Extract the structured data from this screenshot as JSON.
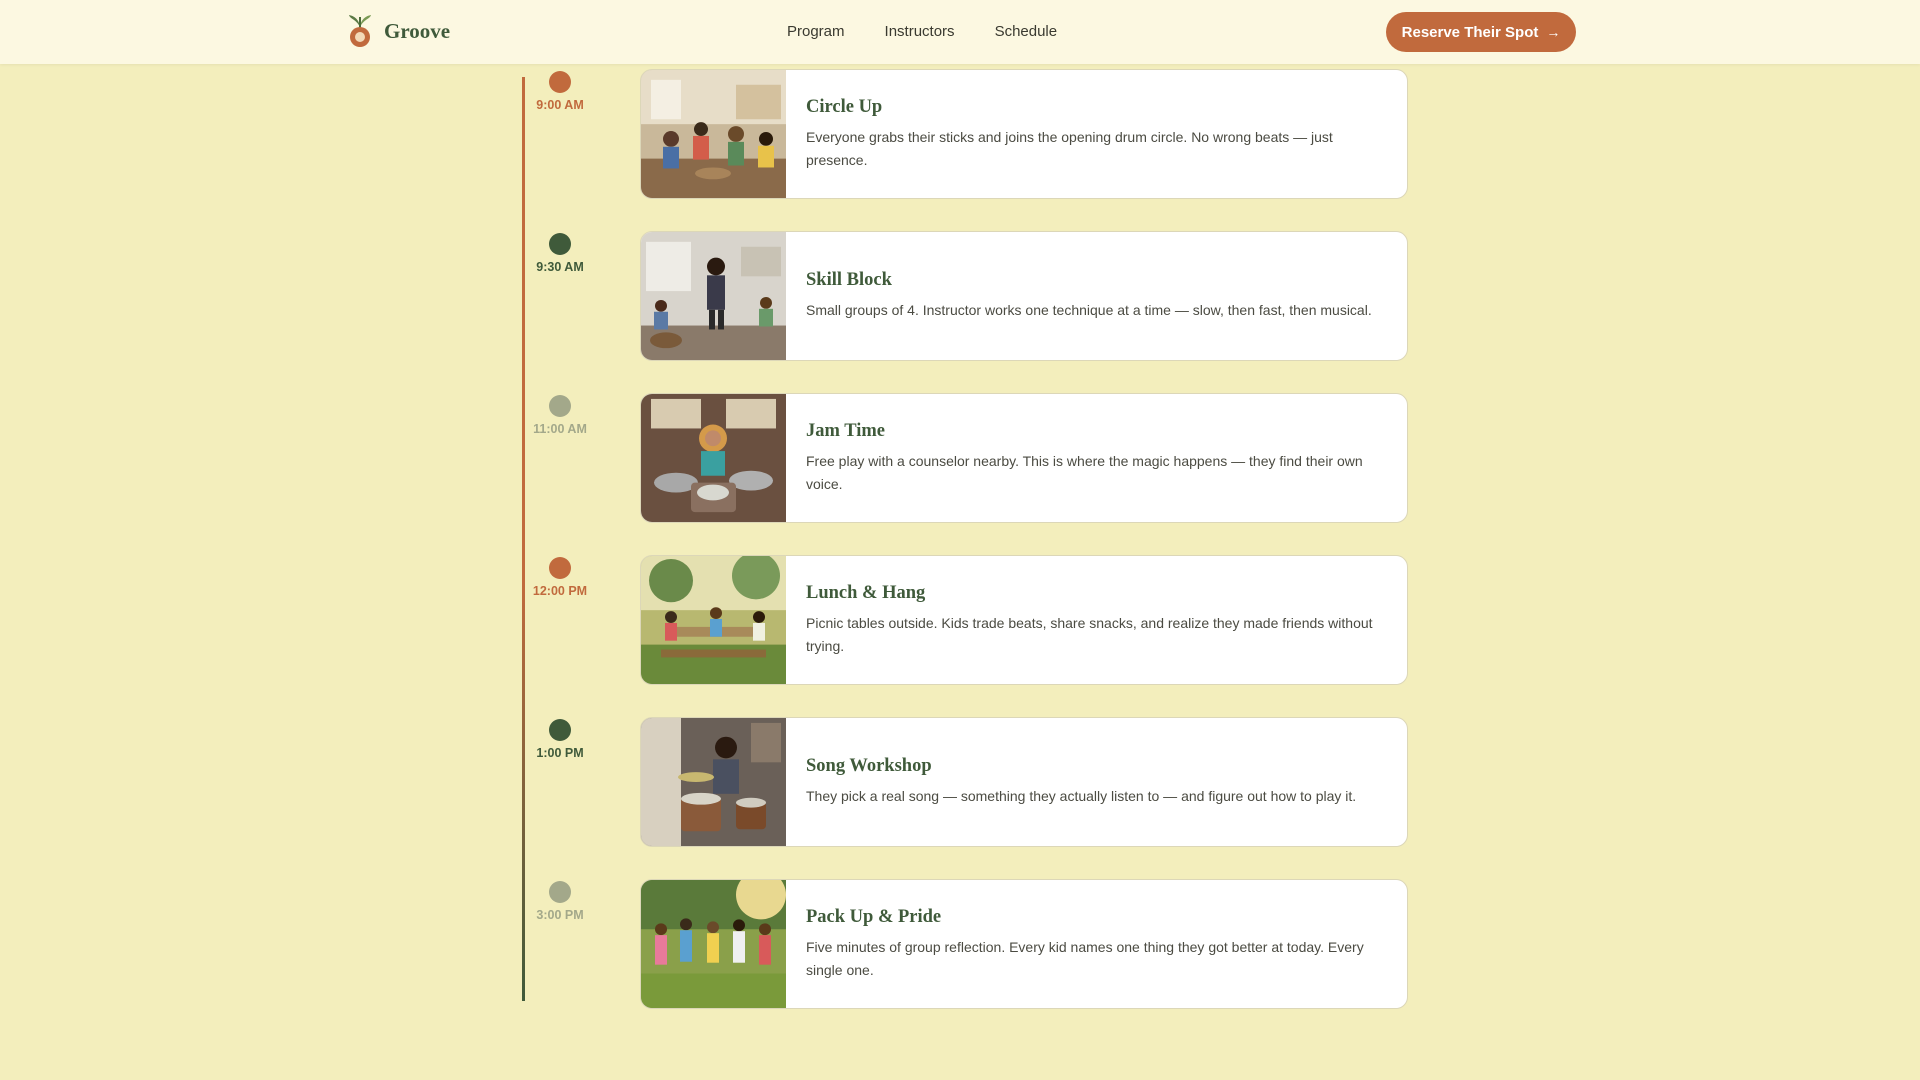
{
  "header": {
    "brand": "Groove",
    "nav": [
      "Program",
      "Instructors",
      "Schedule"
    ],
    "cta_label": "Reserve Their Spot"
  },
  "colors": {
    "background": "#f3eebc",
    "header_bg": "#fcf8e1",
    "accent_orange": "#c16a3d",
    "accent_green": "#3f5a3a",
    "muted_sage": "#a3a88a"
  },
  "schedule": [
    {
      "time": "9:00 AM",
      "title": "Circle Up",
      "description": "Everyone grabs their sticks and joins the opening drum circle. No wrong beats — just presence.",
      "marker": "orange"
    },
    {
      "time": "9:30 AM",
      "title": "Skill Block",
      "description": "Small groups of 4. Instructor works one technique at a time — slow, then fast, then musical.",
      "marker": "green"
    },
    {
      "time": "11:00 AM",
      "title": "Jam Time",
      "description": "Free play with a counselor nearby. This is where the magic happens — they find their own voice.",
      "marker": "sage"
    },
    {
      "time": "12:00 PM",
      "title": "Lunch & Hang",
      "description": "Picnic tables outside. Kids trade beats, share snacks, and realize they made friends without trying.",
      "marker": "orange"
    },
    {
      "time": "1:00 PM",
      "title": "Song Workshop",
      "description": "They pick a real song — something they actually listen to — and figure out how to play it.",
      "marker": "green"
    },
    {
      "time": "3:00 PM",
      "title": "Pack Up & Pride",
      "description": "Five minutes of group reflection. Every kid names one thing they got better at today. Every single one.",
      "marker": "sage"
    }
  ]
}
